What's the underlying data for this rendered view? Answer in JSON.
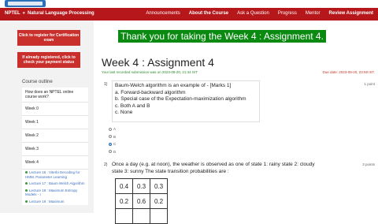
{
  "header": {
    "crumb_1": "NPTEL",
    "crumb_sep": "»",
    "crumb_2": "Natural Language Processing",
    "nav": [
      "Announcements",
      "About the Course",
      "Ask a Question",
      "Progress",
      "Mentor",
      "Review Assignment"
    ]
  },
  "sidebar": {
    "register_btn": "Click to register for Certification exam",
    "payment_btn": "If already registered, click to check your payment status",
    "outline_title": "Course outline",
    "items": [
      "How does an NPTEL online course work?",
      "Week 0",
      "Week 1",
      "Week 2",
      "Week 3",
      "Week 4"
    ],
    "lectures": [
      "Lecture 16 : Viterbi Decoding for HMM, Parameter Learning",
      "Lecture 17 : Baum Welch Algorithm",
      "Lecture 18 : Maximum Entropy Models - I",
      "Lecture 19 : Maximum"
    ]
  },
  "main": {
    "banner": "Thank you for taking the Week 4 : Assignment 4.",
    "title": "Week 4 : Assignment 4",
    "last_submission": "Your last recorded submission was on 2023-08-20, 21:44 IST",
    "due_date": "Due date: 2023-08-20, 23:59 IST.",
    "q1": {
      "number": "1)",
      "points": "1 point",
      "lines": [
        "Baum-Welch algorithm is an example of - [Marks 1]",
        "a. Forward-backward algorithm",
        "b. Special case of the Expectation-maximization algorithm",
        "c. Both A and B",
        "c. None"
      ],
      "options": [
        "A",
        "B",
        "C",
        "D"
      ],
      "selected": "C"
    },
    "q2": {
      "number": "2)",
      "points": "3 points",
      "text": "Once a day (e.g. at noon), the weather is observed as one of state 1: rainy state 2: cloudy state 3: sunny The state transition probabilities are :",
      "matrix": [
        [
          "0.4",
          "0.3",
          "0.3"
        ],
        [
          "0.2",
          "0.6",
          "0.2"
        ],
        [
          "",
          "",
          ""
        ]
      ]
    }
  },
  "colors": {
    "nav_red": "#b5171b",
    "banner_green": "#0b8a12",
    "button_red": "#c9302c"
  }
}
